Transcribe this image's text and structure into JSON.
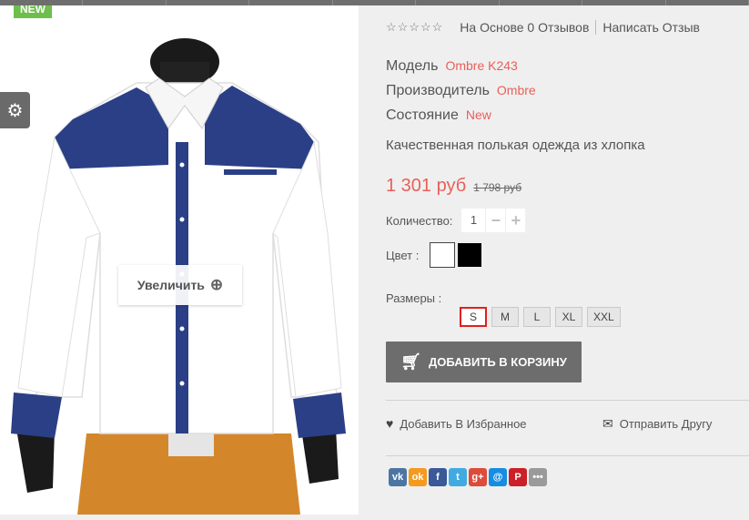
{
  "image": {
    "badge": "NEW",
    "zoom_label": "Увеличить",
    "settings_icon": "gear-icon",
    "zoom_icon": "zoom-in-icon"
  },
  "rating": {
    "stars_filled": 0,
    "stars_total": 5,
    "reviews_link": "На Основе 0 Отзывов",
    "write_review": "Написать Отзыв"
  },
  "meta": {
    "model_label": "Модель",
    "model_value": "Ombre K243",
    "manufacturer_label": "Производитель",
    "manufacturer_value": "Ombre",
    "condition_label": "Состояние",
    "condition_value": "New"
  },
  "description": "Качественная полькая одежда из хлопка",
  "price": {
    "current": "1 301 руб",
    "old": "1 798 руб",
    "color": "#e8605a"
  },
  "quantity": {
    "label": "Количество:",
    "value": "1",
    "minus": "−",
    "plus": "+"
  },
  "color": {
    "label": "Цвет :",
    "options": [
      "#ffffff",
      "#000000"
    ]
  },
  "sizes": {
    "label": "Размеры :",
    "options": [
      "S",
      "M",
      "L",
      "XL",
      "XXL"
    ],
    "selected": "S"
  },
  "cart_button": "ДОБАВИТЬ В КОРЗИНУ",
  "actions": {
    "wishlist": "Добавить В Избранное",
    "tell_friend": "Отправить Другу"
  },
  "share": [
    {
      "name": "vk-icon",
      "glyph": "vk",
      "color": "#4c75a3"
    },
    {
      "name": "odnoklassniki-icon",
      "glyph": "ok",
      "color": "#f59a1e"
    },
    {
      "name": "facebook-icon",
      "glyph": "f",
      "color": "#3b5998"
    },
    {
      "name": "twitter-icon",
      "glyph": "t",
      "color": "#41abe1"
    },
    {
      "name": "google-plus-icon",
      "glyph": "g+",
      "color": "#dd4b39"
    },
    {
      "name": "mail-ru-icon",
      "glyph": "@",
      "color": "#168de2"
    },
    {
      "name": "pinterest-icon",
      "glyph": "P",
      "color": "#cb2027"
    },
    {
      "name": "more-icon",
      "glyph": "•••",
      "color": "#9a9a9a"
    }
  ]
}
